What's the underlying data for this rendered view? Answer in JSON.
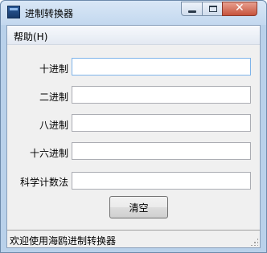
{
  "window": {
    "title": "进制转换器"
  },
  "menu": {
    "help": "帮助(H)"
  },
  "fields": [
    {
      "label": "十进制",
      "value": ""
    },
    {
      "label": "二进制",
      "value": ""
    },
    {
      "label": "八进制",
      "value": ""
    },
    {
      "label": "十六进制",
      "value": ""
    },
    {
      "label": "科学计数法",
      "value": ""
    }
  ],
  "buttons": {
    "clear": "清空"
  },
  "status": {
    "text": "欢迎使用海鸥进制转换器"
  },
  "icons": {
    "app": "app-icon",
    "minimize": "minimize-icon",
    "maximize": "maximize-icon",
    "close": "close-icon",
    "grip": "resize-grip-icon"
  },
  "colors": {
    "frame": "#b9d1ea",
    "client": "#f0f0f0",
    "focus_border": "#7eb4ea",
    "close_button": "#c7533c"
  }
}
